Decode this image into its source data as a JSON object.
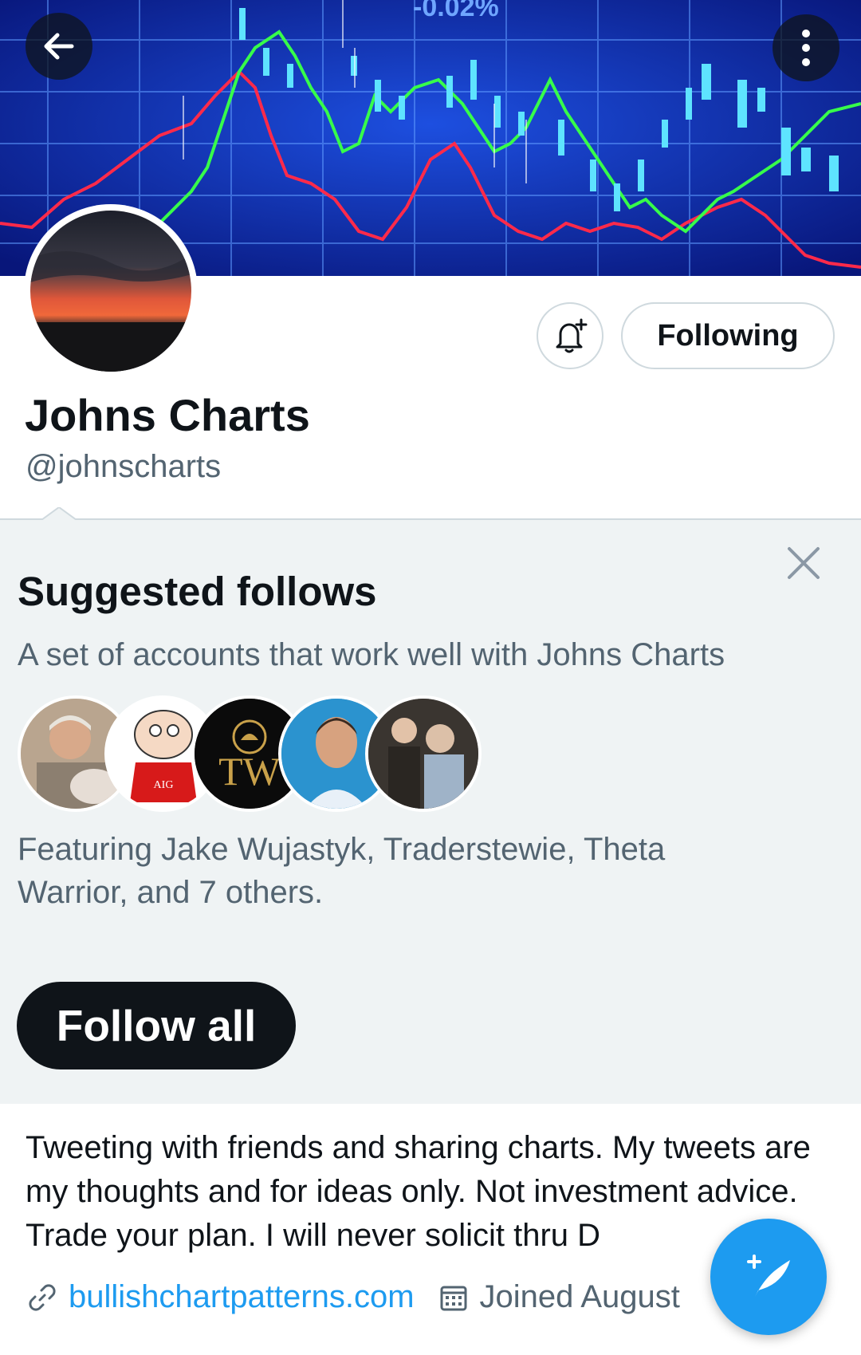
{
  "profile": {
    "display_name": "Johns Charts",
    "handle": "@johnscharts",
    "bio": "Tweeting with friends and sharing charts. My tweets are my thoughts and for ideas only. Not investment advice. Trade your plan. I will never solicit thru D",
    "website": "bullishchartpatterns.com",
    "joined": "Joined August"
  },
  "header": {
    "banner_text": "-0.02%",
    "following_label": "Following"
  },
  "suggested": {
    "title": "Suggested follows",
    "subtitle": "A set of accounts that work well with Johns Charts",
    "featuring": "Featuring Jake Wujastyk, Traderstewie, Theta Warrior, and 7 others.",
    "follow_all_label": "Follow all",
    "avatars": [
      {
        "label": ""
      },
      {
        "label": "AIG"
      },
      {
        "label": "TW"
      },
      {
        "label": ""
      },
      {
        "label": ""
      }
    ]
  },
  "colors": {
    "accent": "#1d9bf0",
    "text_primary": "#0f1419",
    "text_secondary": "#536471",
    "panel_bg": "#eff3f4",
    "banner_bg": "#0a1f8a"
  },
  "icons": {
    "back": "arrow-left-icon",
    "more": "more-vertical-icon",
    "bell": "bell-plus-icon",
    "close": "close-icon",
    "link": "link-icon",
    "calendar": "calendar-icon",
    "compose": "compose-tweet-icon"
  }
}
